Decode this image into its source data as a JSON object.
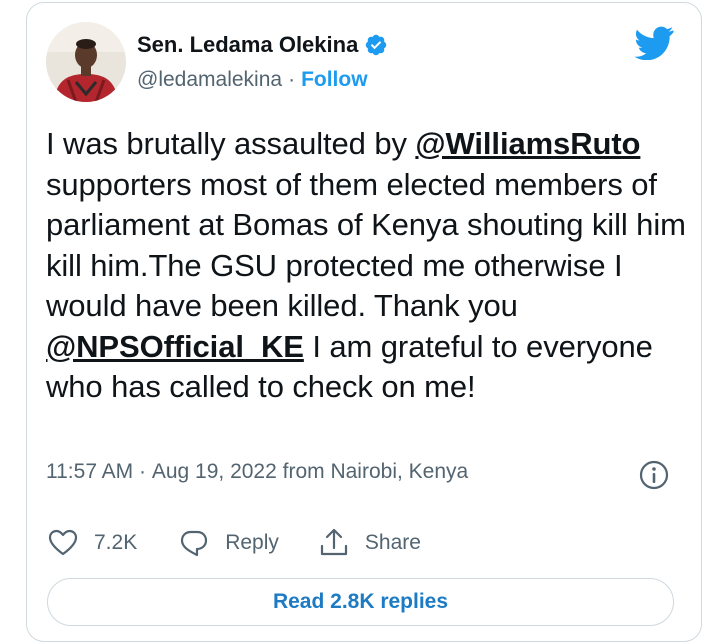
{
  "author": {
    "name": "Sen. Ledama Olekina",
    "handle": "@ledamalekina",
    "separator": "·",
    "follow_label": "Follow"
  },
  "tweet": {
    "parts": [
      {
        "text": "I was brutally assaulted by ",
        "mention": false
      },
      {
        "text": "@WilliamsRuto",
        "mention": true
      },
      {
        "text": " supporters most of them elected members of parliament at Bomas of Kenya shouting kill him kill him.The GSU protected me otherwise I would have been killed. Thank you ",
        "mention": false
      },
      {
        "text": "@NPSOfficial_KE",
        "mention": true
      },
      {
        "text": " I am grateful to everyone who has called to check on me!",
        "mention": false
      }
    ],
    "time": "11:57 AM",
    "separator": " · ",
    "date": "Aug 19, 2022",
    "location": " from Nairobi, Kenya"
  },
  "actions": {
    "like_count": "7.2K",
    "reply_label": "Reply",
    "share_label": "Share"
  },
  "read_replies_label": "Read 2.8K replies",
  "colors": {
    "twitter_blue": "#1d9bf0",
    "text": "#0f1419",
    "secondary": "#536471",
    "border": "#cfd9de"
  },
  "icons": [
    "avatar-image",
    "verified-badge-icon",
    "twitter-bird-icon",
    "info-icon",
    "heart-icon",
    "reply-bubble-icon",
    "share-icon"
  ]
}
